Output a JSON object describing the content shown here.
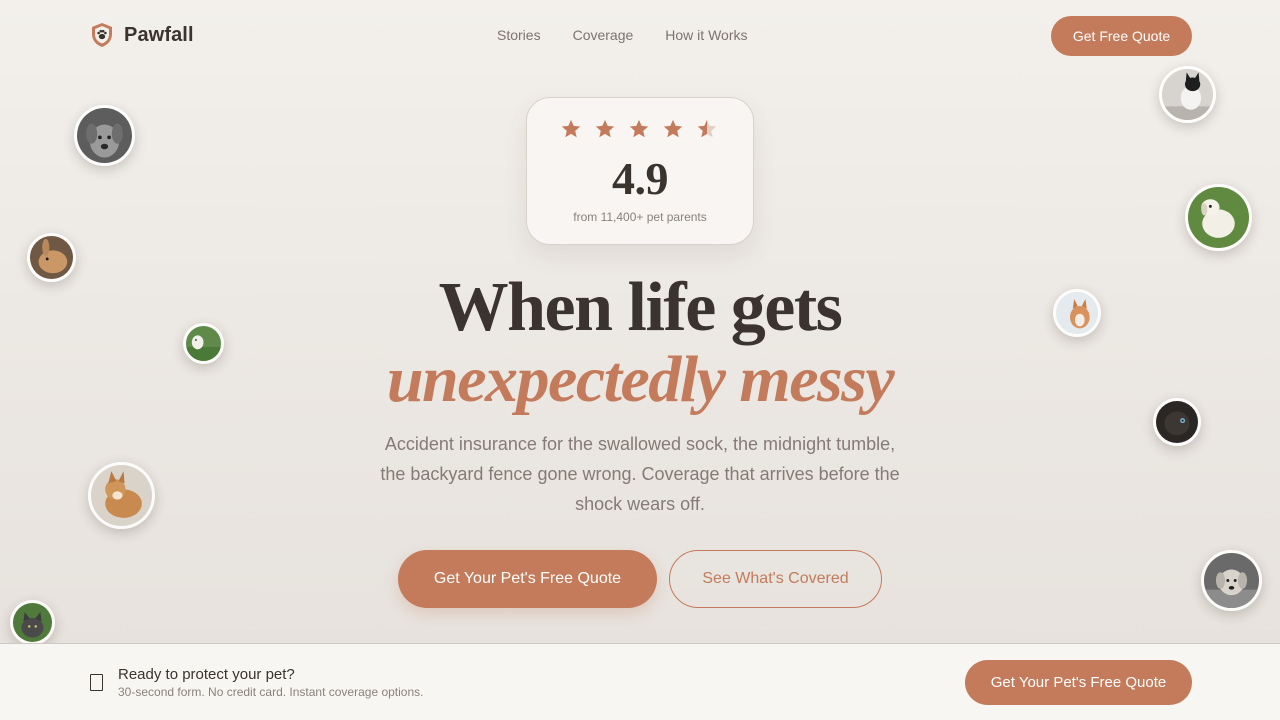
{
  "brand": {
    "name": "Pawfall",
    "logo_icon": "shield-paw-icon"
  },
  "nav": {
    "links": [
      "Stories",
      "Coverage",
      "How it Works"
    ],
    "cta_label": "Get Free Quote"
  },
  "rating": {
    "stars_full": 4,
    "stars_half": 1,
    "value": "4.9",
    "subtitle": "from 11,400+ pet parents"
  },
  "hero": {
    "headline_line1": "When life gets",
    "headline_line2": "unexpectedly messy",
    "subtext": "Accident insurance for the swallowed sock, the midnight tumble, the backyard fence gone wrong. Coverage that arrives before the shock wears off.",
    "primary_cta": "Get Your Pet's Free Quote",
    "secondary_cta": "See What's Covered"
  },
  "sticky_bar": {
    "icon": "document-icon",
    "title": "Ready to protect your pet?",
    "subtitle": "30-second form. No credit card. Instant coverage options.",
    "cta_label": "Get Your Pet's Free Quote"
  },
  "pet_photos": [
    "grey-dog-photo",
    "rabbit-photo",
    "white-dog-on-grass-photo",
    "corgi-photo",
    "tabby-cat-photo",
    "black-white-cat-photo",
    "labrador-photo",
    "husky-photo",
    "siamese-cat-photo",
    "golden-retriever-photo"
  ],
  "colors": {
    "accent": "#c47b5b",
    "text_dark": "#3a332e",
    "text_muted": "#857b75",
    "background": "#eeeae5"
  }
}
